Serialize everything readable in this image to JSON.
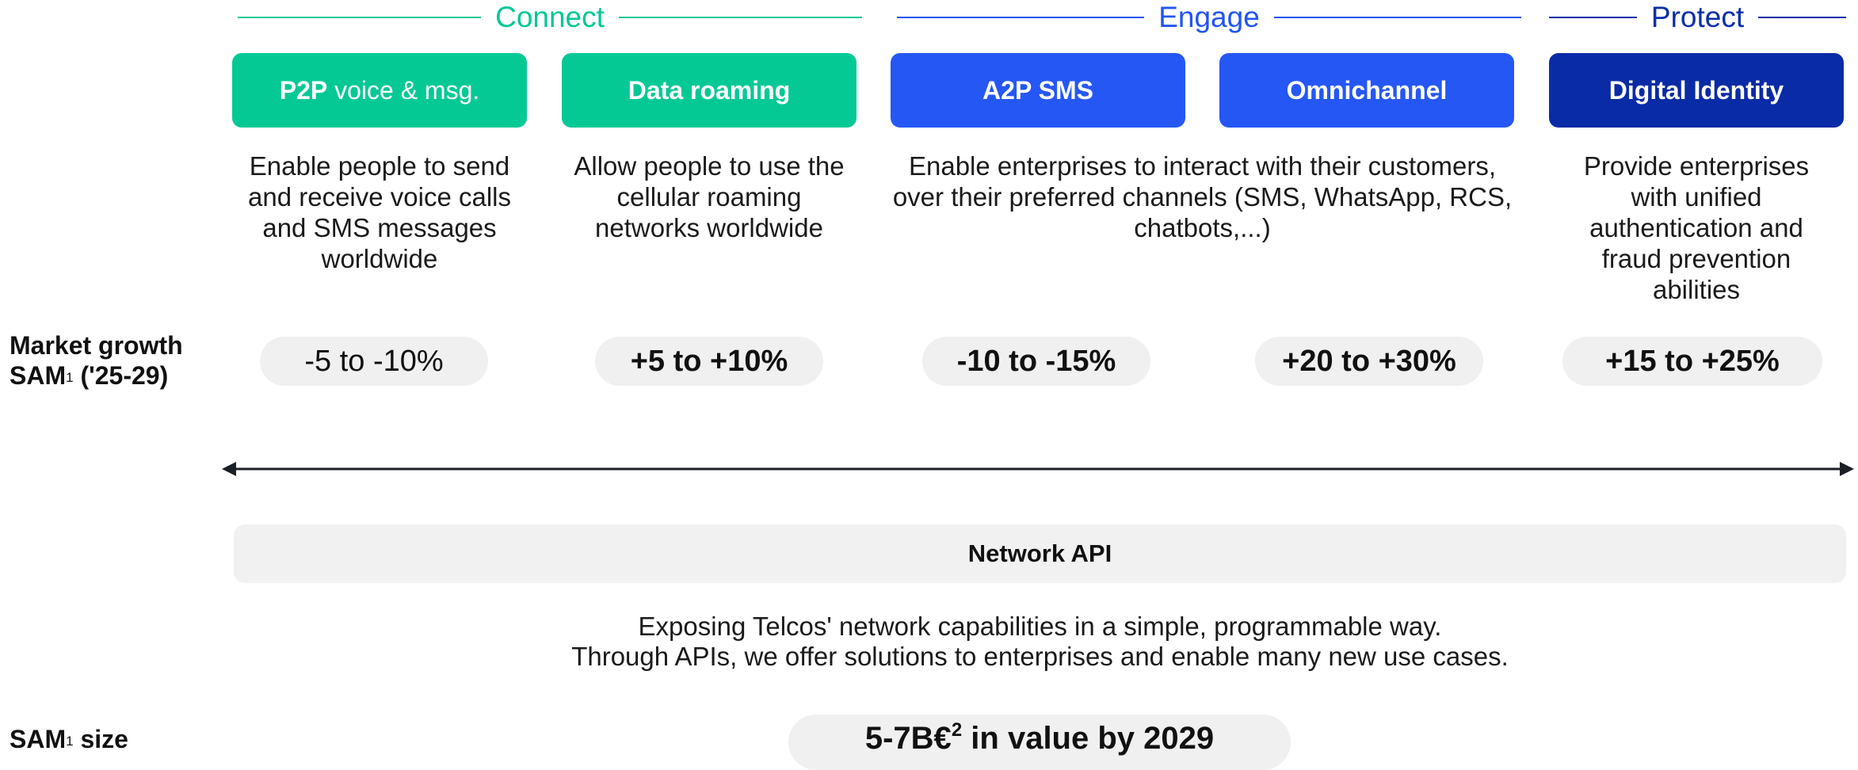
{
  "groups": {
    "connect": "Connect",
    "engage": "Engage",
    "protect": "Protect"
  },
  "tiles": {
    "p2p_bold": "P2P",
    "p2p_rest": " voice & msg.",
    "data_roaming": "Data roaming",
    "a2p_sms": "A2P SMS",
    "omnichannel": "Omnichannel",
    "digital_identity": "Digital Identity"
  },
  "descriptions": {
    "p2p": "Enable people to send and receive voice calls and SMS messages worldwide",
    "roaming": "Allow people to use the cellular roaming networks worldwide",
    "engage": "Enable enterprises to interact with their customers, over their preferred channels (SMS, WhatsApp, RCS, chatbots,...)",
    "protect": "Provide enterprises with unified authentication and fraud prevention abilities"
  },
  "growth_label": {
    "line1": "Market growth",
    "line2_prefix": "SAM",
    "line2_sup": "1",
    "line2_suffix": " ('25-29)"
  },
  "growth": {
    "p2p": "-5 to -10%",
    "roaming": "+5 to +10%",
    "a2p": "-10 to -15%",
    "omni": "+20 to +30%",
    "identity": "+15 to +25%"
  },
  "network_api": {
    "title": "Network API",
    "desc_line1": "Exposing Telcos' network capabilities in a simple, programmable way.",
    "desc_line2": "Through APIs, we offer solutions to enterprises and enable many new use cases."
  },
  "size_label": {
    "prefix": "SAM",
    "sup": "1",
    "suffix": " size"
  },
  "size_value": {
    "prefix": "5-7B€",
    "sup": "2",
    "suffix": " in value by 2029"
  },
  "colors": {
    "connect": "#00c896",
    "engage": "#2155f2",
    "protect": "#0a2ea8",
    "pill_bg": "#f0f0f0"
  }
}
